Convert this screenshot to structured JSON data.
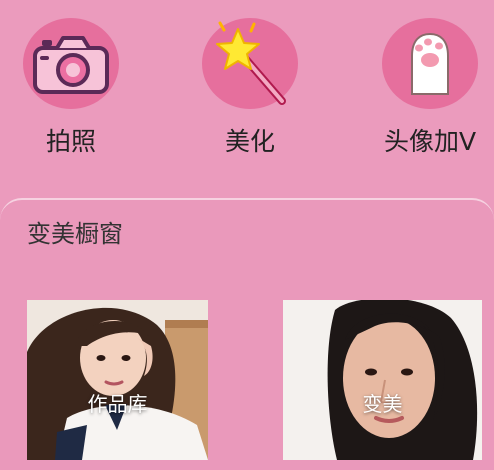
{
  "actions": [
    {
      "label": "拍照",
      "icon": "camera-icon"
    },
    {
      "label": "美化",
      "icon": "magic-wand-icon"
    },
    {
      "label": "头像加V",
      "icon": "cat-paw-icon"
    }
  ],
  "showcase": {
    "title": "变美橱窗",
    "cards": [
      {
        "label": "作品库"
      },
      {
        "label": "变美"
      }
    ]
  }
}
